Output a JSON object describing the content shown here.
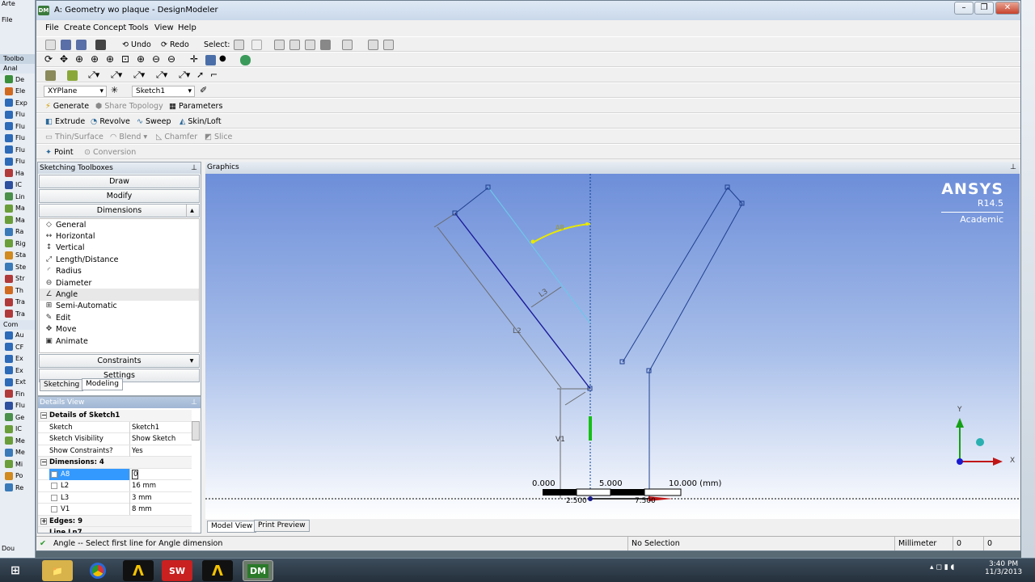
{
  "background_app": {
    "title": "Arte",
    "menu": "File",
    "toolbox_header": "Toolbo",
    "section1": "Anal",
    "items1": [
      "De",
      "Ele",
      "Exp",
      "Flu",
      "Flu",
      "Flu",
      "Flu",
      "Flu",
      "Ha",
      "IC",
      "Lin",
      "Ma",
      "Ma",
      "Ra",
      "Rig",
      "Sta",
      "Ste",
      "Str",
      "Th",
      "Tra",
      "Tra"
    ],
    "section2": "Com",
    "items2": [
      "Au",
      "CF",
      "Ex",
      "Ex",
      "Ext",
      "Fin",
      "Flu",
      "Ge",
      "IC",
      "Me",
      "Me",
      "Mi",
      "Po",
      "Re"
    ],
    "bottom": "Dou",
    "colors": [
      "#3b8f3b",
      "#d06a20",
      "#2d6ab8",
      "#2d6ab8",
      "#2d6ab8",
      "#2d6ab8",
      "#2d6ab8",
      "#2d6ab8",
      "#b03a3a",
      "#2d4f9e",
      "#4a8f4a",
      "#6a9e3a",
      "#6a9e3a",
      "#3a7ab8",
      "#6a9e3a",
      "#d08a20",
      "#3a7ab8",
      "#b03a3a",
      "#d06a20",
      "#b03a3a",
      "#b03a3a"
    ]
  },
  "window": {
    "title": "A: Geometry wo plaque - DesignModeler",
    "app_icon": "DM"
  },
  "menu": [
    "File",
    "Create",
    "Concept",
    "Tools",
    "View",
    "Help"
  ],
  "toolbar1": {
    "undo": "Undo",
    "redo": "Redo",
    "select": "Select:"
  },
  "toolbar4": {
    "plane": "XYPlane",
    "sketch": "Sketch1"
  },
  "toolbar5": {
    "generate": "Generate",
    "share_topology": "Share Topology",
    "parameters": "Parameters"
  },
  "toolbar6": {
    "extrude": "Extrude",
    "revolve": "Revolve",
    "sweep": "Sweep",
    "skin_loft": "Skin/Loft"
  },
  "toolbar7": {
    "thin_surface": "Thin/Surface",
    "blend": "Blend",
    "chamfer": "Chamfer",
    "slice": "Slice"
  },
  "toolbar8": {
    "point": "Point",
    "conversion": "Conversion"
  },
  "sketching": {
    "header": "Sketching Toolboxes",
    "draw": "Draw",
    "modify": "Modify",
    "dimensions": "Dimensions",
    "items": [
      {
        "label": "General",
        "icon": "general-dimension-icon",
        "glyph": "◇"
      },
      {
        "label": "Horizontal",
        "icon": "horizontal-dimension-icon",
        "glyph": "↔"
      },
      {
        "label": "Vertical",
        "icon": "vertical-dimension-icon",
        "glyph": "↕"
      },
      {
        "label": "Length/Distance",
        "icon": "length-distance-icon",
        "glyph": "⤢"
      },
      {
        "label": "Radius",
        "icon": "radius-icon",
        "glyph": "◜"
      },
      {
        "label": "Diameter",
        "icon": "diameter-icon",
        "glyph": "⊖"
      },
      {
        "label": "Angle",
        "icon": "angle-icon",
        "glyph": "∠"
      },
      {
        "label": "Semi-Automatic",
        "icon": "semi-automatic-icon",
        "glyph": "⊞"
      },
      {
        "label": "Edit",
        "icon": "edit-icon",
        "glyph": "✎"
      },
      {
        "label": "Move",
        "icon": "move-icon",
        "glyph": "✥"
      },
      {
        "label": "Animate",
        "icon": "animate-icon",
        "glyph": "▣"
      }
    ],
    "constraints": "Constraints",
    "settings": "Settings",
    "tab_sketching": "Sketching",
    "tab_modeling": "Modeling"
  },
  "details": {
    "header": "Details View",
    "group1": "Details of Sketch1",
    "rows1": [
      [
        "Sketch",
        "Sketch1"
      ],
      [
        "Sketch Visibility",
        "Show Sketch"
      ],
      [
        "Show Constraints?",
        "Yes"
      ]
    ],
    "group2": "Dimensions: 4",
    "rows2": [
      [
        "A8",
        "0"
      ],
      [
        "L2",
        "16 mm"
      ],
      [
        "L3",
        "3 mm"
      ],
      [
        "V1",
        "8 mm"
      ]
    ],
    "group3": "Edges: 9",
    "group4": "Line Ln7"
  },
  "graphics": {
    "header": "Graphics",
    "brand": "ANSYS",
    "version": "R14.5",
    "edition": "Academic",
    "dim_labels": {
      "l2": "L2",
      "l3": "L3",
      "v1": "V1",
      "a8": "A8"
    },
    "scale": {
      "s0": "0.000",
      "s1": "5.000",
      "s2": "10.000 (mm)",
      "s3": "2.500",
      "s4": "7.500"
    },
    "axis": {
      "x": "X",
      "y": "Y"
    },
    "tab_model": "Model View",
    "tab_print": "Print Preview"
  },
  "status": {
    "message": "Angle -- Select first line for Angle dimension",
    "selection": "No Selection",
    "units": "Millimeter",
    "v1": "0",
    "v2": "0"
  },
  "taskbar": {
    "time": "3:40 PM",
    "date": "11/3/2013",
    "apps": [
      "folder-icon",
      "chrome-icon",
      "ansys-workbench-icon",
      "solidworks-icon",
      "ansys-icon",
      "designmodeler-icon"
    ]
  }
}
